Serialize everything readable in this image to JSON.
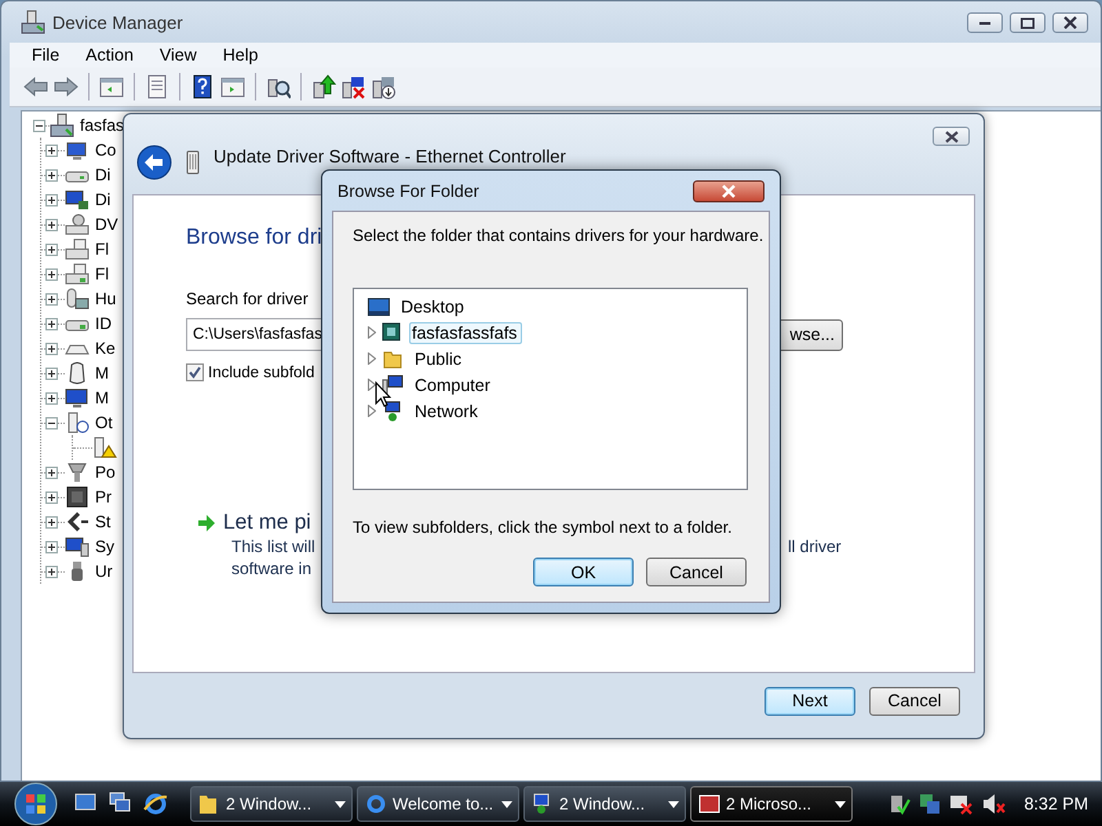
{
  "device_manager": {
    "title": "Device Manager",
    "menu": [
      "File",
      "Action",
      "View",
      "Help"
    ],
    "tree": {
      "label": "fasfas",
      "expanded": true,
      "children": [
        {
          "label": "Co",
          "expanded": false
        },
        {
          "label": "Di",
          "expanded": false
        },
        {
          "label": "Di",
          "expanded": false
        },
        {
          "label": "DV",
          "expanded": false
        },
        {
          "label": "Fl",
          "expanded": false
        },
        {
          "label": "Fl",
          "expanded": false
        },
        {
          "label": "Hu",
          "expanded": false
        },
        {
          "label": "ID",
          "expanded": false
        },
        {
          "label": "Ke",
          "expanded": false
        },
        {
          "label": "M",
          "expanded": false
        },
        {
          "label": "M",
          "expanded": false
        },
        {
          "label": "Ot",
          "expanded": true,
          "children": [
            {
              "warning": true
            }
          ]
        },
        {
          "label": "Po",
          "expanded": false
        },
        {
          "label": "Pr",
          "expanded": false
        },
        {
          "label": "St",
          "expanded": false
        },
        {
          "label": "Sy",
          "expanded": false
        },
        {
          "label": "Ur",
          "expanded": false
        }
      ]
    }
  },
  "wizard": {
    "title": "Update Driver Software - Ethernet Controller",
    "heading": "Browse for dri",
    "search_label": "Search for driver",
    "path_field": {
      "value": "C:\\Users\\fasfasfas"
    },
    "browse_button": "wse...",
    "include_subfolders": {
      "label": "Include subfold",
      "checked": true
    },
    "option": {
      "title": "Let me pi",
      "text_left": [
        "This list will",
        "software in"
      ],
      "text_right": "ll driver"
    },
    "buttons": [
      {
        "label": "Next",
        "default": true
      },
      {
        "label": "Cancel",
        "default": false
      }
    ]
  },
  "dialog": {
    "title": "Browse For Folder",
    "instruction": "Select the folder that contains drivers for your hardware.",
    "tree": {
      "label": "Desktop",
      "selected": false,
      "children": [
        {
          "label": "fasfasfassfafs",
          "selected": true
        },
        {
          "label": "Public",
          "selected": false
        },
        {
          "label": "Computer",
          "selected": false
        },
        {
          "label": "Network",
          "selected": false
        }
      ]
    },
    "hint": "To view subfolders, click the symbol next to a folder.",
    "buttons": [
      {
        "label": "OK",
        "default": true
      },
      {
        "label": "Cancel",
        "default": false
      }
    ]
  },
  "taskbar": {
    "tasks": [
      {
        "label": "2 Window...",
        "active": false
      },
      {
        "label": "Welcome to...",
        "active": false
      },
      {
        "label": "2 Window...",
        "active": false
      },
      {
        "label": "2 Microso...",
        "active": true
      }
    ],
    "clock": "8:32 PM"
  }
}
